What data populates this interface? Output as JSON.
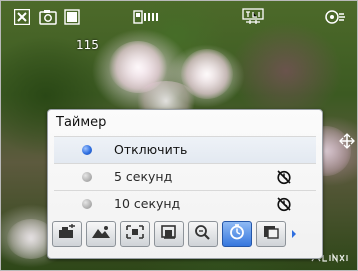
{
  "status_bar": {
    "shots_remaining": "115",
    "icons": [
      "close-icon",
      "camera-mode-icon",
      "battery-icon",
      "scene-mode-icon",
      "white-balance-icon",
      "settings-icon"
    ]
  },
  "timer_menu": {
    "title": "Таймер",
    "options": [
      {
        "label": "Отключить",
        "selected": true,
        "icon": null
      },
      {
        "label": "5 секунд",
        "selected": false,
        "icon": "self-timer-icon"
      },
      {
        "label": "10 секунд",
        "selected": false,
        "icon": "self-timer-icon"
      }
    ]
  },
  "toolbar": {
    "buttons": [
      {
        "name": "exposure-icon",
        "active": false
      },
      {
        "name": "landscape-icon",
        "active": false
      },
      {
        "name": "metering-icon",
        "active": false
      },
      {
        "name": "image-size-icon",
        "active": false
      },
      {
        "name": "zoom-icon",
        "active": false
      },
      {
        "name": "timer-icon",
        "active": true
      },
      {
        "name": "frame-icon",
        "active": false
      }
    ]
  },
  "colors": {
    "accent": "#3677de",
    "panel_bg": "#f4f4f4"
  }
}
